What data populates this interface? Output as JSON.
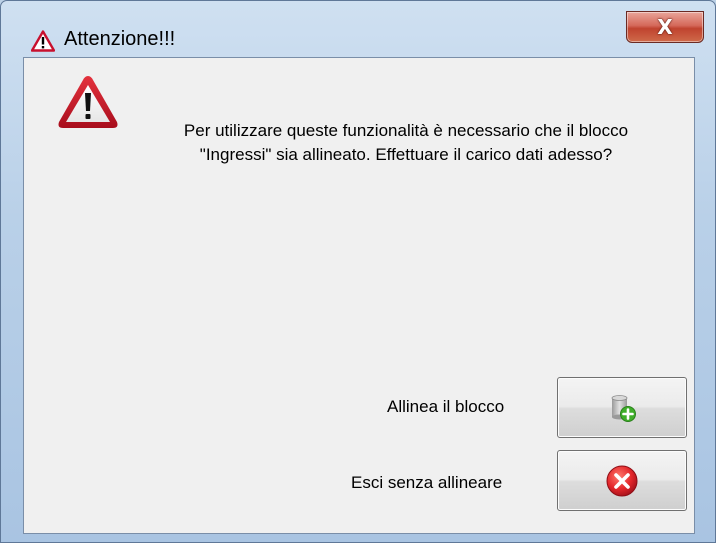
{
  "window": {
    "title": "Attenzione!!!",
    "close_glyph": "X",
    "title_icon": "warning-icon"
  },
  "dialog": {
    "icon": "warning-icon",
    "message": "Per utilizzare queste funzionalità è necessario che il blocco \"Ingressi\" sia allineato. Effettuare il carico dati adesso?"
  },
  "actions": [
    {
      "label": "Allinea il blocco",
      "icon": "database-add-icon"
    },
    {
      "label": "Esci senza allineare",
      "icon": "red-cancel-icon"
    }
  ],
  "colors": {
    "warning_red": "#c8102e",
    "cancel_red": "#e3262a",
    "add_green": "#3fae2a"
  }
}
